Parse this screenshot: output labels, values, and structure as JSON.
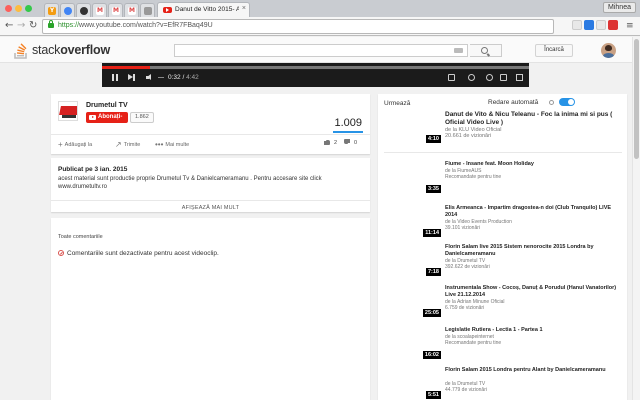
{
  "browser": {
    "tab_title": "Danut de Vitto 2015- A",
    "profile": "Mihnea",
    "url_scheme": "https://",
    "url_rest": "www.youtube.com/watch?v=EfR7FBaq49U",
    "tabs": [
      "youtube-favicon",
      "chrome-favicon",
      "github-favicon",
      "gmail-favicon",
      "gmail-favicon",
      "gmail-favicon",
      "generic-favicon"
    ]
  },
  "header": {
    "logo_light": "stack",
    "logo_bold": "overflow",
    "login": "Încarcă"
  },
  "player": {
    "current_time": "0:32",
    "duration": "4:42",
    "played_fraction": 0.113
  },
  "owner": {
    "channel": "Drumetul TV",
    "subscribe": "Abonați-vă",
    "subscribers": "1.862",
    "views": "1.009",
    "likes": "2",
    "dislikes": "0",
    "like_fraction": 1.0,
    "add_to": "Adăugați la",
    "share": "Trimite",
    "more": "Mai multe"
  },
  "description": {
    "published": "Publicat pe 3 ian. 2015",
    "text": "acest material sunt productie proprie Drumetul Tv & Danielcameramanu . Pentru accesare site click www.drumetultv.ro",
    "show_more": "AFIȘEAZĂ MAI MULT"
  },
  "comments": {
    "heading": "Toate comentariile",
    "disabled": "Comentariile sunt dezactivate pentru acest videoclip."
  },
  "sidebar": {
    "up_next": "Urmează",
    "autoplay": "Redare automată",
    "autoplay_on": true,
    "videos": [
      {
        "title": "Danut de Vito & Nicu Teleanu - Foc la inima mi si pus ( Oficial Video Live )",
        "channel": "de la KLU Video Oficial",
        "views": "20.661 de vizionări",
        "duration": "4:10"
      },
      {
        "title": "Fiume - Insane feat. Moon Holiday",
        "channel": "de la FiumeAUS",
        "views": "Recomandate pentru tine",
        "duration": "3:35"
      },
      {
        "title": "Elis Armeanca - Impartim dragostea-n doi (Club Tranquilo) LIVE 2014",
        "channel": "de la Video Events Production",
        "views": "39.101 vizionări",
        "duration": "11:14"
      },
      {
        "title": "Florin Salam live 2015 Sistem nenorocite 2015 Londra by Danielcameramanu",
        "channel": "de la Drumetul TV",
        "views": "392.622 de vizionări",
        "duration": "7:18"
      },
      {
        "title": "Instrumentala Show - Cocoș, Danuț & Porudul (Hanul Vanatorilor) Live 21.12.2014",
        "channel": "de la Adrian Minune Oficial",
        "views": "6.759 de vizionări",
        "duration": "25:05"
      },
      {
        "title": "Legislatie Rutiera - Lectia 1 - Partea 1",
        "channel": "de la scoalapeinternet",
        "views": "Recomandate pentru tine",
        "duration": "16:02"
      },
      {
        "title": "Florin Salam 2015 Londra pentru Alant by Danielcameramanu",
        "channel": "de la Drumetul TV",
        "views": "44.779 de vizionări",
        "duration": "5:51"
      }
    ]
  },
  "colors": {
    "youtube_red": "#e62117",
    "accent_blue": "#2793e6",
    "https_green": "#2a8f2a",
    "so_orange": "#f48024"
  }
}
